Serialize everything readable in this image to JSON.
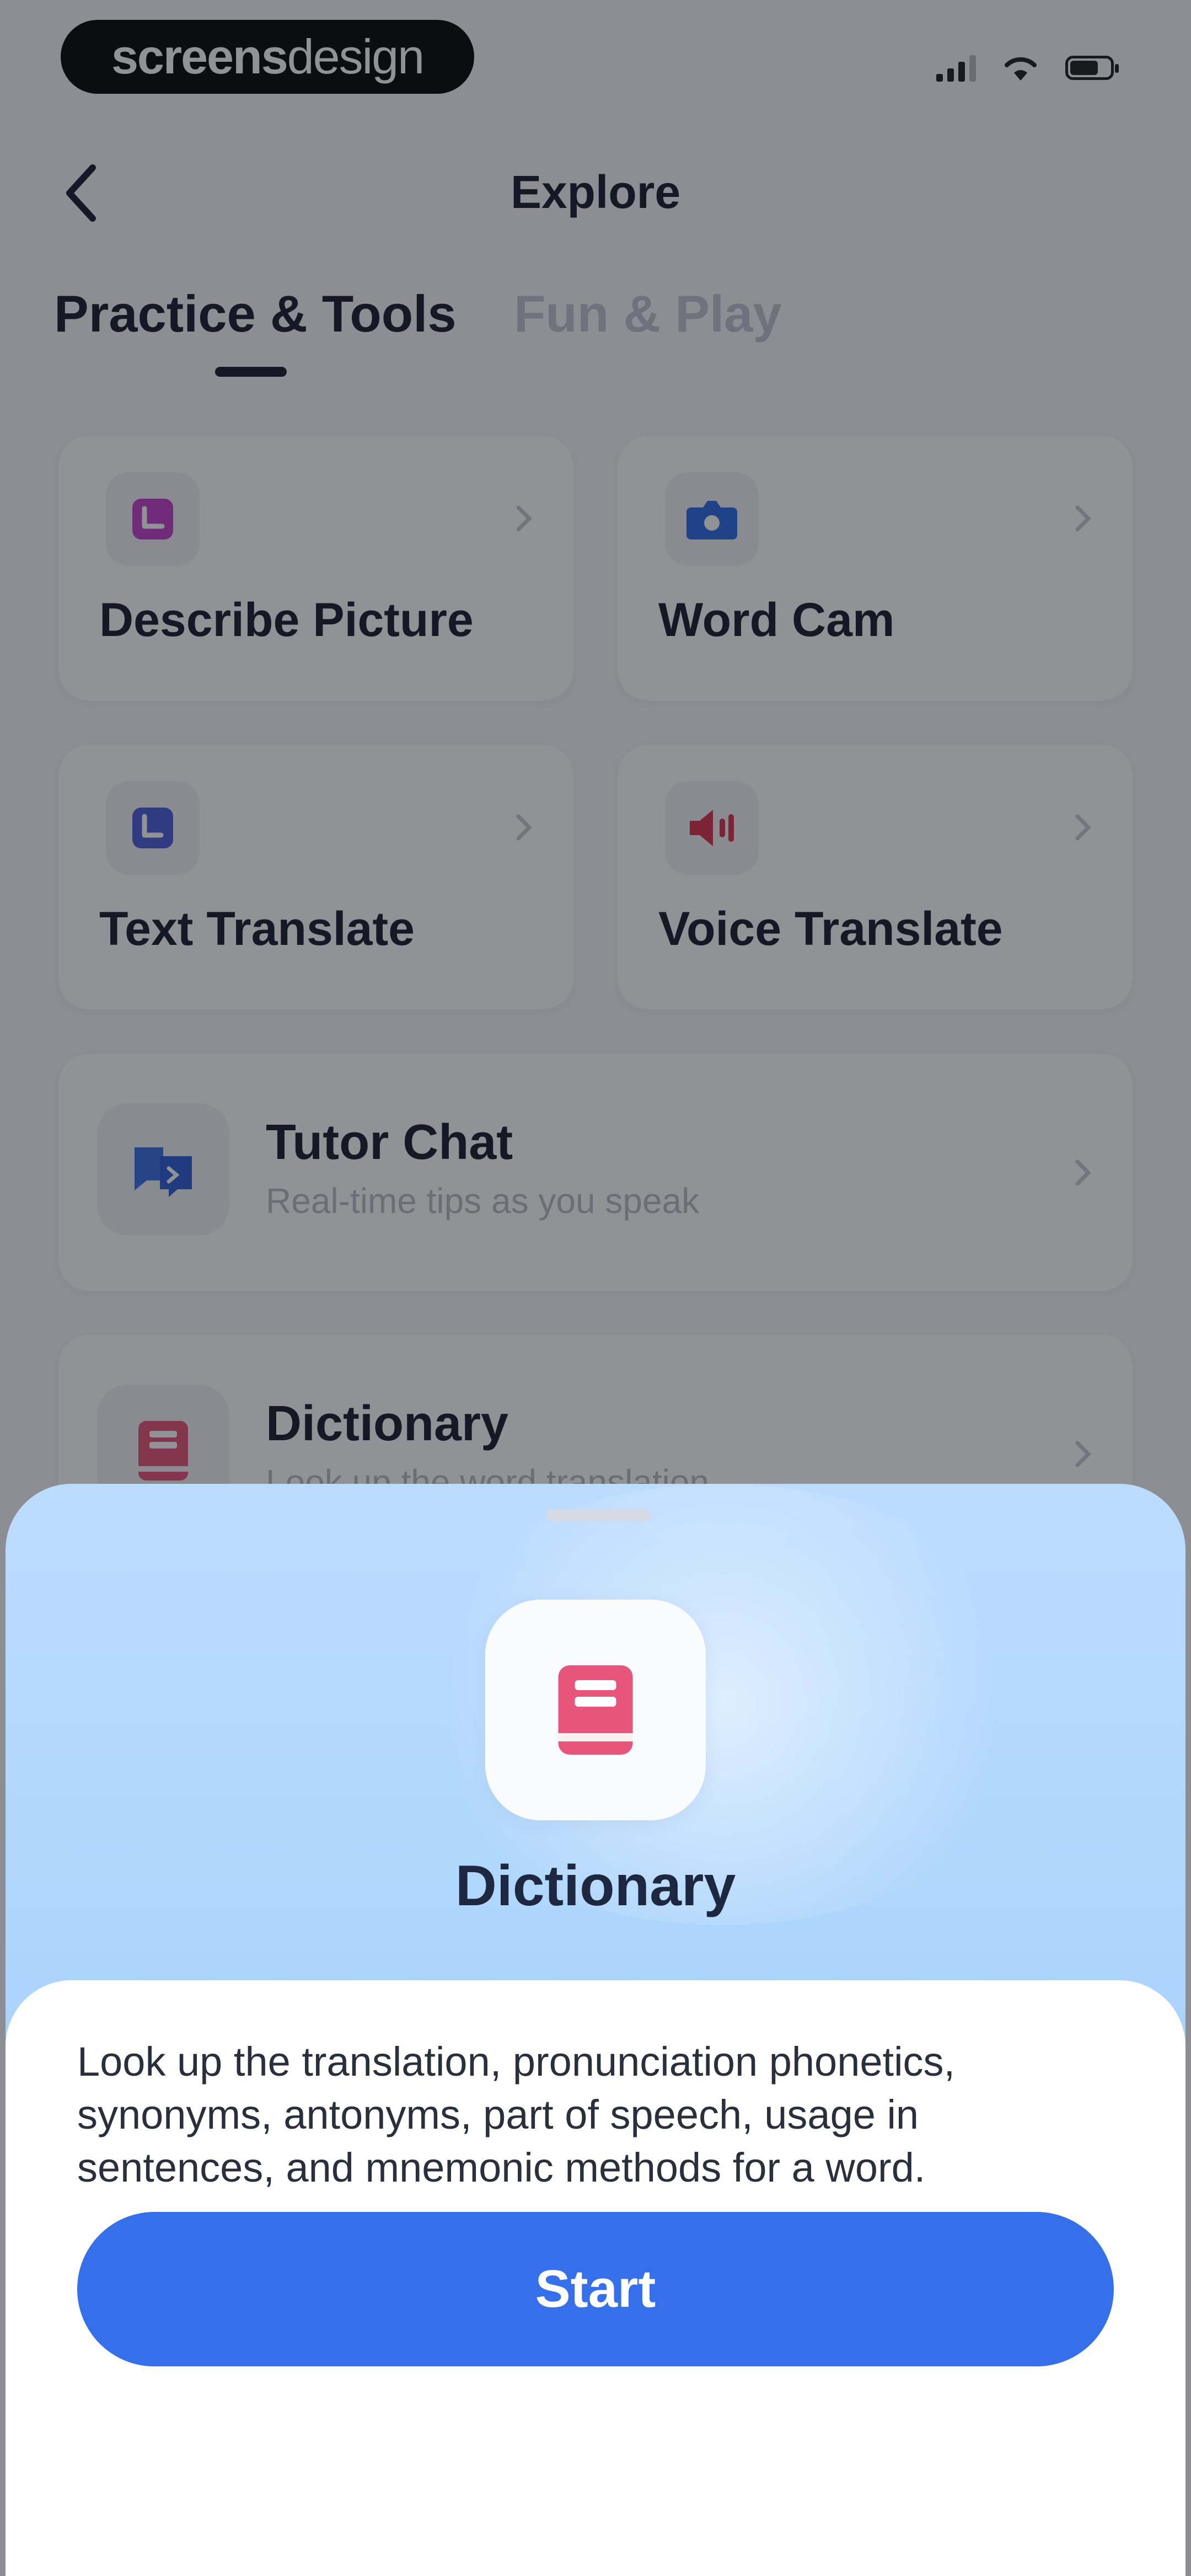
{
  "status_bar": {
    "watermark_bold": "screens",
    "watermark_light": "design"
  },
  "header": {
    "title": "Explore"
  },
  "tabs": [
    {
      "label": "Practice & Tools"
    },
    {
      "label": "Fun & Play"
    }
  ],
  "tools": [
    {
      "label": "Describe Picture",
      "icon": "picture-icon"
    },
    {
      "label": "Word Cam",
      "icon": "camera-icon"
    },
    {
      "label": "Text Translate",
      "icon": "translate-icon"
    },
    {
      "label": "Voice Translate",
      "icon": "speaker-icon"
    }
  ],
  "features": [
    {
      "title": "Tutor Chat",
      "subtitle": "Real-time tips as you speak",
      "icon": "chat-icon"
    },
    {
      "title": "Dictionary",
      "subtitle": "Look up the word translation",
      "icon": "book-icon"
    }
  ],
  "sheet": {
    "title": "Dictionary",
    "description": "Look up the translation, pronunciation phonetics, synonyms, antonyms, part of speech, usage in sentences, and mnemonic methods for a word.",
    "start_label": "Start"
  },
  "colors": {
    "accent": "#3570ea",
    "book_pink": "#e8557a",
    "camera_blue": "#2f6ee6",
    "picture_magenta": "#c544c9",
    "speaker_red": "#d8324f"
  }
}
